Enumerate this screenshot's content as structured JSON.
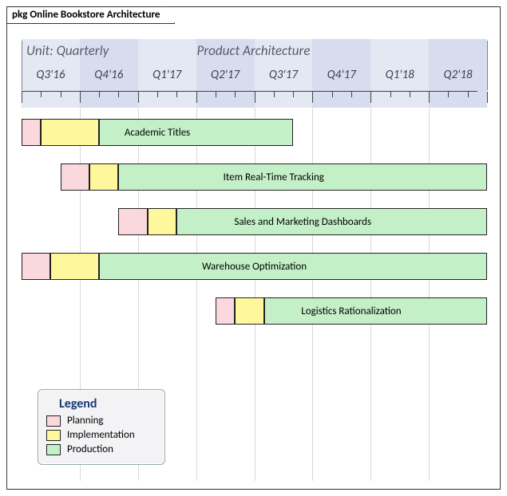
{
  "frame_title": "pkg Online Bookstore Architecture",
  "unit_label": "Unit: Quarterly",
  "chart_title": "Product Architecture",
  "legend": {
    "title": "Legend",
    "planning": "Planning",
    "implementation": "Implementation",
    "production": "Production"
  },
  "timeline": {
    "quarters": [
      "Q3'16",
      "Q4'16",
      "Q1'17",
      "Q2'17",
      "Q3'17",
      "Q4'17",
      "Q1'18",
      "Q2'18"
    ]
  },
  "rows": [
    {
      "label": "Academic Titles"
    },
    {
      "label": "Item Real-Time Tracking"
    },
    {
      "label": "Sales and Marketing Dashboards"
    },
    {
      "label": "Warehouse Optimization"
    },
    {
      "label": "Logistics Rationalization"
    }
  ],
  "chart_data": {
    "type": "bar",
    "title": "Product Architecture",
    "xlabel": "Quarterly",
    "ylabel": "",
    "x_unit": "month",
    "x_origin": "2016-07",
    "x_range_months": [
      0,
      24
    ],
    "categories": [
      "Academic Titles",
      "Item Real-Time Tracking",
      "Sales and Marketing Dashboards",
      "Warehouse Optimization",
      "Logistics Rationalization"
    ],
    "series": [
      {
        "name": "Planning",
        "color": "#fbd7de",
        "ranges": [
          [
            0,
            1
          ],
          [
            2,
            3.5
          ],
          [
            5,
            6.5
          ],
          [
            0,
            1.5
          ],
          [
            10,
            11
          ]
        ]
      },
      {
        "name": "Implementation",
        "color": "#fef79b",
        "ranges": [
          [
            1,
            4
          ],
          [
            3.5,
            5
          ],
          [
            6.5,
            8
          ],
          [
            1.5,
            4
          ],
          [
            11,
            12.5
          ]
        ]
      },
      {
        "name": "Production",
        "color": "#c4f0c8",
        "ranges": [
          [
            4,
            14
          ],
          [
            5,
            24
          ],
          [
            8,
            24
          ],
          [
            4,
            24
          ],
          [
            12.5,
            24
          ]
        ]
      }
    ],
    "quarter_ticks": [
      "Q3'16",
      "Q4'16",
      "Q1'17",
      "Q2'17",
      "Q3'17",
      "Q4'17",
      "Q1'18",
      "Q2'18"
    ]
  }
}
